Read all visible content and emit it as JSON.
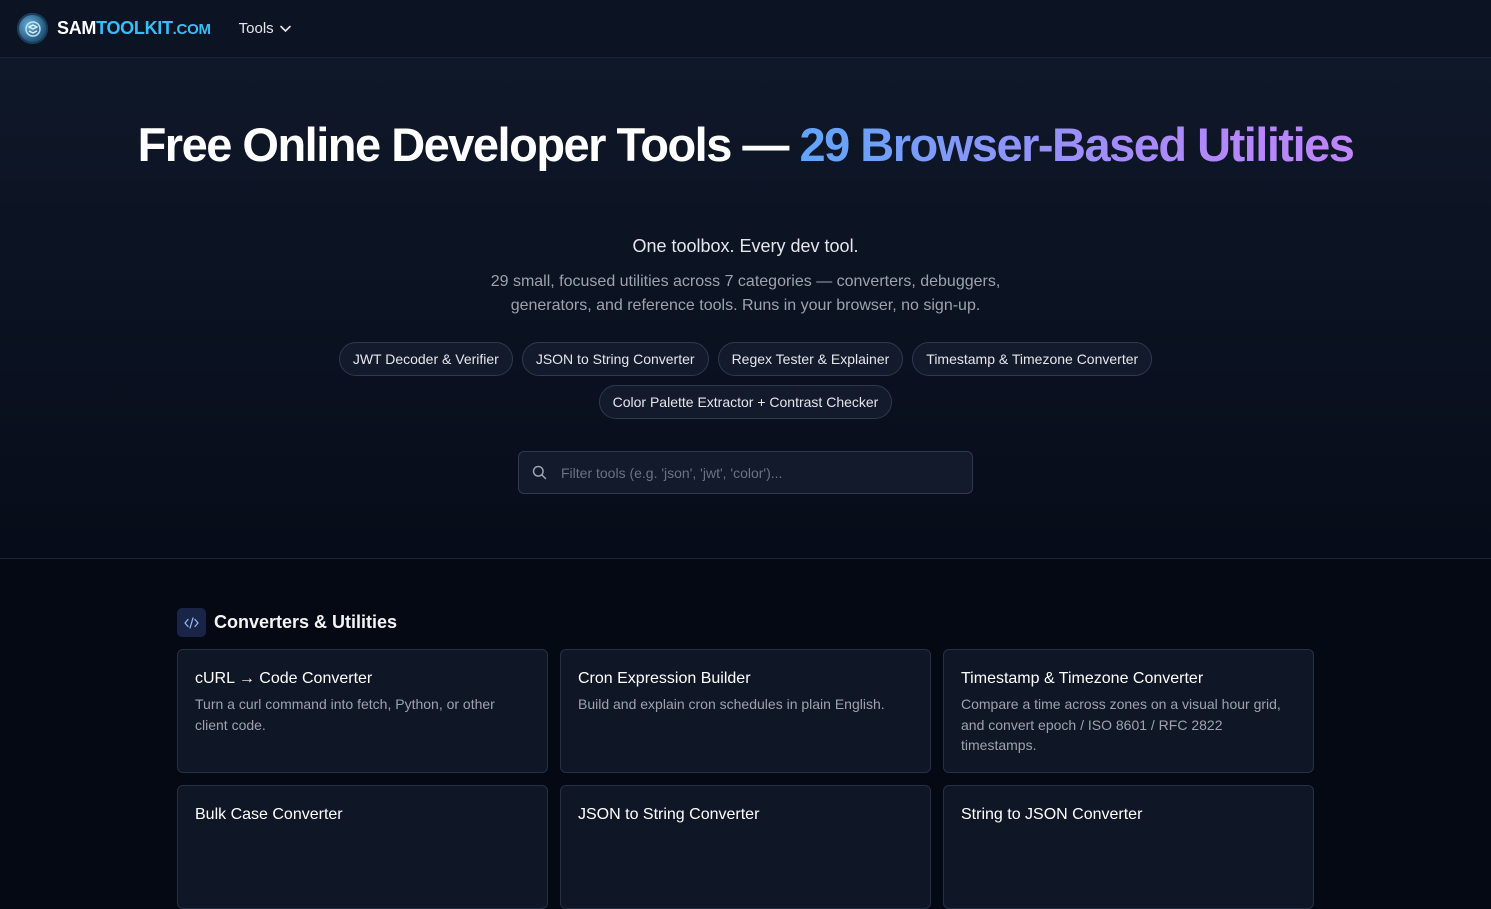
{
  "header": {
    "logo_part1": "SAM",
    "logo_part2": "TOOLKIT",
    "logo_part3": ".COM",
    "tools_menu_label": "Tools"
  },
  "hero": {
    "title_plain": "Free Online Developer Tools — ",
    "title_highlight": "29 Browser-Based Utilities",
    "tagline": "One toolbox. Every dev tool.",
    "description": "29 small, focused utilities across 7 categories — converters, debuggers, generators, and reference tools. Runs in your browser, no sign-up.",
    "chips": [
      "JWT Decoder & Verifier",
      "JSON to String Converter",
      "Regex Tester & Explainer",
      "Timestamp & Timezone Converter",
      "Color Palette Extractor + Contrast Checker"
    ]
  },
  "search": {
    "placeholder": "Filter tools (e.g. 'json', 'jwt', 'color')...",
    "value": ""
  },
  "section": {
    "title": "Converters & Utilities",
    "icon": "code-icon",
    "cards": [
      {
        "title": "cURL → Code Converter",
        "desc": "Turn a curl command into fetch, Python, or other client code."
      },
      {
        "title": "Cron Expression Builder",
        "desc": "Build and explain cron schedules in plain English."
      },
      {
        "title": "Timestamp & Timezone Converter",
        "desc": "Compare a time across zones on a visual hour grid, and convert epoch / ISO 8601 / RFC 2822 timestamps."
      },
      {
        "title": "Bulk Case Converter",
        "desc": ""
      },
      {
        "title": "JSON to String Converter",
        "desc": ""
      },
      {
        "title": "String to JSON Converter",
        "desc": ""
      }
    ]
  },
  "colors": {
    "accent_cyan": "#38bdf8",
    "gradient_start": "#60a5fa",
    "gradient_end": "#c084fc"
  }
}
